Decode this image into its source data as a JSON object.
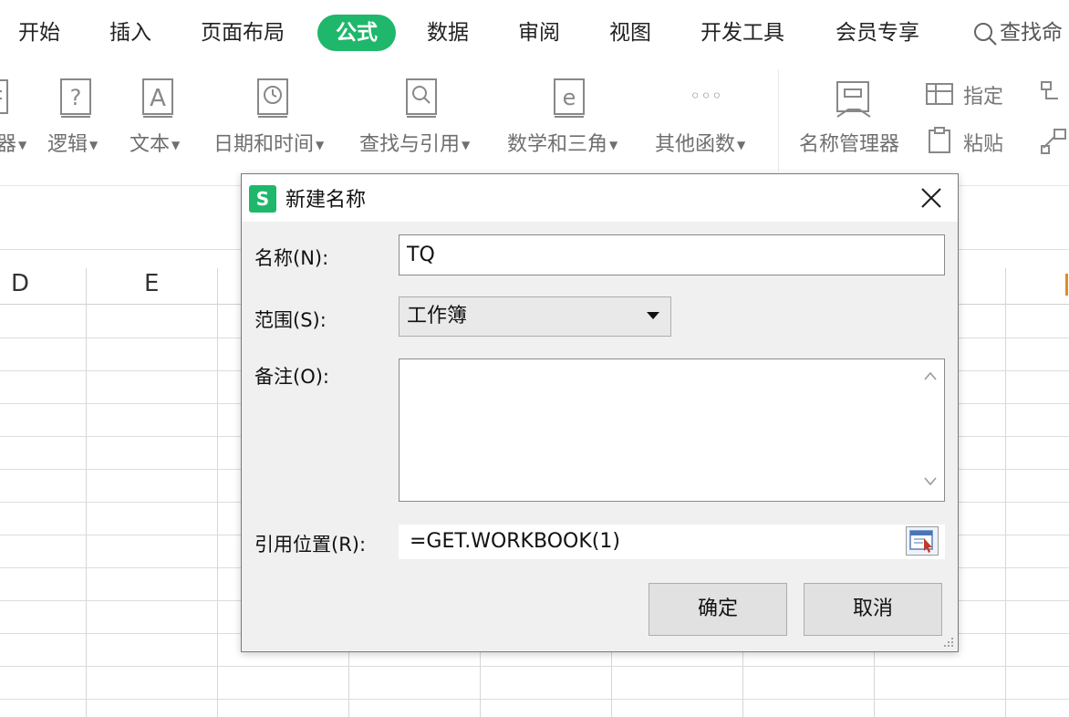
{
  "tabs": [
    {
      "label": "开始",
      "active": false
    },
    {
      "label": "插入",
      "active": false
    },
    {
      "label": "页面布局",
      "active": false
    },
    {
      "label": "公式",
      "active": true
    },
    {
      "label": "数据",
      "active": false
    },
    {
      "label": "审阅",
      "active": false
    },
    {
      "label": "视图",
      "active": false
    },
    {
      "label": "开发工具",
      "active": false
    },
    {
      "label": "会员专享",
      "active": false
    }
  ],
  "search_label": "查找命",
  "ribbon": {
    "partial_left_label": "器",
    "logic": "逻辑",
    "text": "文本",
    "datetime": "日期和时间",
    "lookup": "查找与引用",
    "math": "数学和三角",
    "other": "其他函数",
    "name_manager": "名称管理器",
    "assign": "指定",
    "paste": "粘贴",
    "icon_letters": {
      "logic": "?",
      "text": "A",
      "math": "e",
      "other": "◦◦◦"
    }
  },
  "column_headers": [
    "D",
    "E"
  ],
  "dialog": {
    "title": "新建名称",
    "logo": "S",
    "name_label": "名称(N):",
    "name_value": "TQ",
    "scope_label": "范围(S):",
    "scope_value": "工作簿",
    "comment_label": "备注(O):",
    "comment_value": "",
    "ref_label": "引用位置(R):",
    "ref_value": "=GET.WORKBOOK(1)",
    "ok_label": "确定",
    "cancel_label": "取消"
  },
  "colors": {
    "accent": "#1fb76b",
    "dialog_bg": "#f0f0f0",
    "button_bg": "#e1e1e1"
  }
}
